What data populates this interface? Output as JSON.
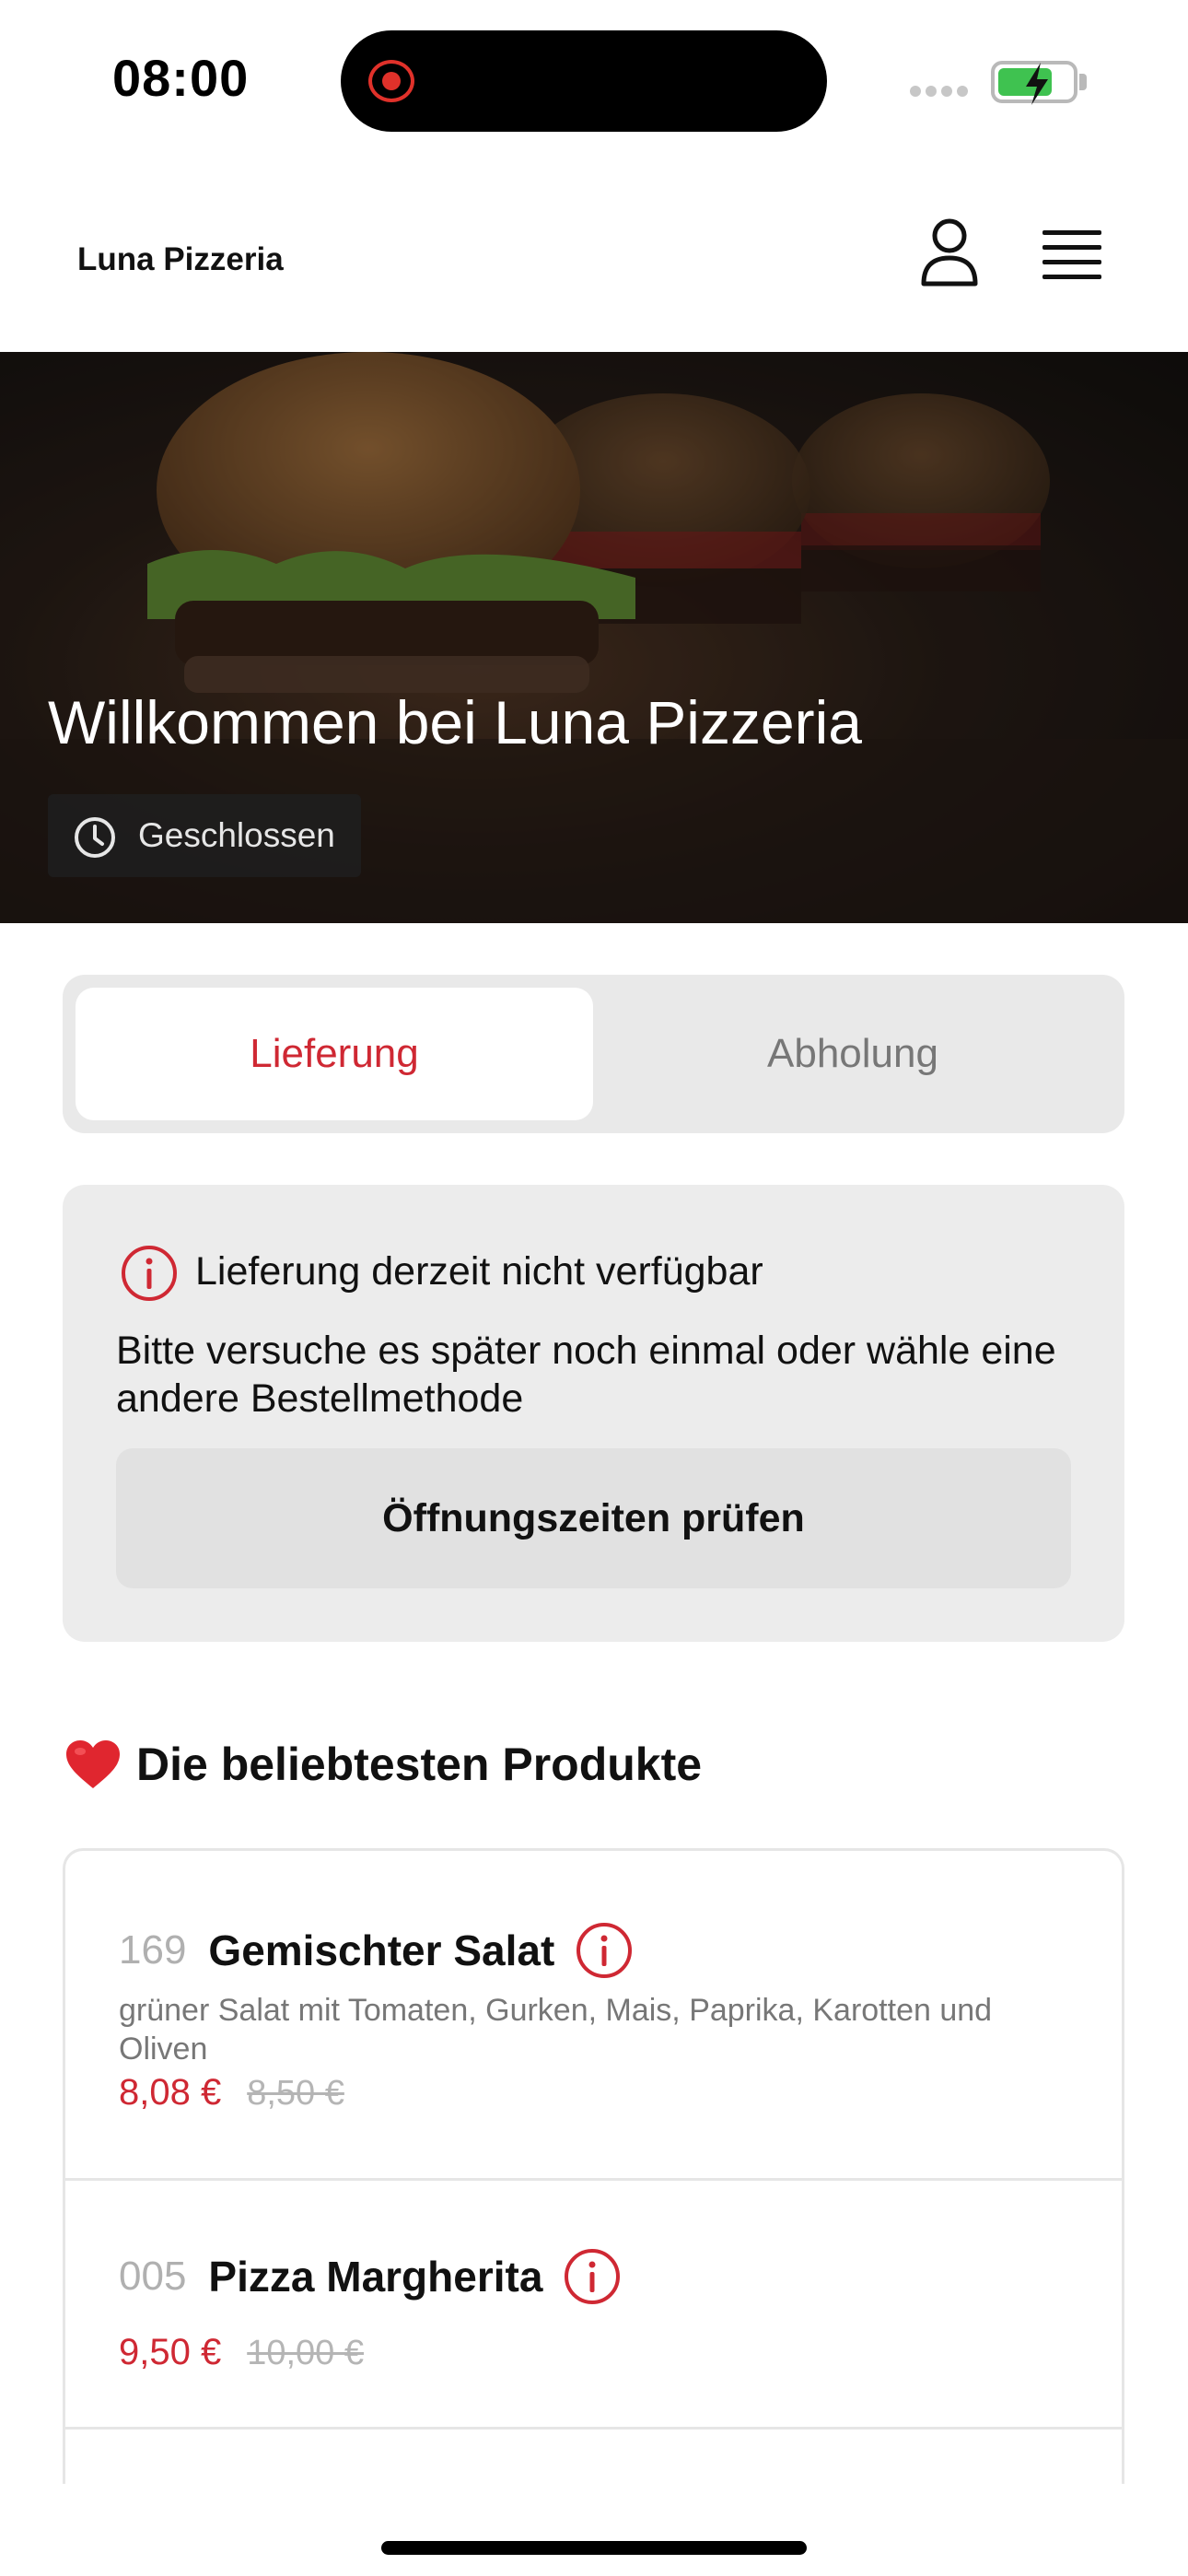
{
  "status_bar": {
    "time": "08:00"
  },
  "header": {
    "brand": "Luna Pizzeria"
  },
  "hero": {
    "title": "Willkommen bei Luna Pizzeria",
    "status": "Geschlossen"
  },
  "tabs": [
    {
      "label": "Lieferung",
      "active": true
    },
    {
      "label": "Abholung",
      "active": false
    }
  ],
  "notice": {
    "title": "Lieferung derzeit nicht verfügbar",
    "text": "Bitte versuche es später noch einmal oder wähle eine andere Bestellmethode",
    "button": "Öffnungszeiten prüfen"
  },
  "popular": {
    "title": "Die beliebtesten Produkte",
    "items": [
      {
        "number": "169",
        "name": "Gemischter Salat",
        "description": "grüner Salat mit Tomaten, Gurken, Mais, Paprika, Karotten und Oliven",
        "price": "8,08 €",
        "old_price": "8,50 €"
      },
      {
        "number": "005",
        "name": "Pizza Margherita",
        "description": "",
        "price": "9,50 €",
        "old_price": "10,00 €"
      }
    ]
  },
  "colors": {
    "accent": "#cf2833",
    "battery": "#3fc250"
  },
  "icons": [
    "record-icon",
    "battery-icon",
    "user-icon",
    "menu-icon",
    "clock-icon",
    "info-icon",
    "heart-icon"
  ]
}
